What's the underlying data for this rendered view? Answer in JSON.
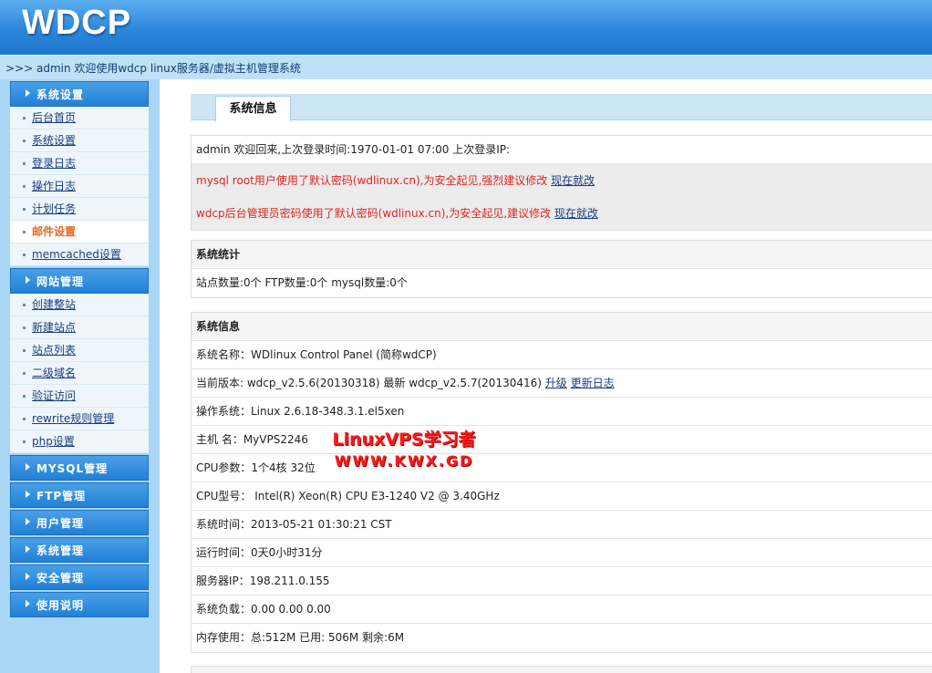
{
  "header": {
    "logo": "WDCP"
  },
  "welcome": ">>> admin 欢迎使用wdcp linux服务器/虚拟主机管理系统",
  "sidebar": {
    "groups": [
      {
        "title": "系统设置",
        "items": [
          "后台首页",
          "系统设置",
          "登录日志",
          "操作日志",
          "计划任务",
          "邮件设置",
          "memcached设置"
        ],
        "active": "邮件设置"
      },
      {
        "title": "网站管理",
        "items": [
          "创建整站",
          "新建站点",
          "站点列表",
          "二级域名",
          "验证访问",
          "rewrite规则管理",
          "php设置"
        ]
      },
      {
        "title": "MYSQL管理",
        "items": []
      },
      {
        "title": "FTP管理",
        "items": []
      },
      {
        "title": "用户管理",
        "items": []
      },
      {
        "title": "系统管理",
        "items": []
      },
      {
        "title": "安全管理",
        "items": []
      },
      {
        "title": "使用说明",
        "items": []
      }
    ]
  },
  "main": {
    "tab": "系统信息",
    "login_info": "admin 欢迎回来,上次登录时间:1970-01-01 07:00 上次登录IP:",
    "warnings": [
      {
        "text": "mysql root用户使用了默认密码(wdlinux.cn),为安全起见,强烈建议修改",
        "link": "现在就改"
      },
      {
        "text": "wdcp后台管理员密码使用了默认密码(wdlinux.cn),为安全起见,建议修改",
        "link": "现在就改"
      }
    ],
    "stats": {
      "title": "系统统计",
      "summary": "站点数量:0个  FTP数量:0个  mysql数量:0个"
    },
    "sysinfo": {
      "title": "系统信息",
      "name": "系统名称：WDlinux Control Panel (简称wdCP)",
      "version": "当前版本: wdcp_v2.5.6(20130318) 最新 wdcp_v2.5.7(20130416)",
      "version_link_upgrade": "升级",
      "version_link_changelog": "更新日志",
      "os": "操作系统：Linux 2.6.18-348.3.1.el5xen",
      "host": "主机 名：MyVPS2246",
      "cpu_params": "CPU参数：1个4核 32位",
      "cpu_model": "CPU型号： Intel(R) Xeon(R) CPU E3-1240 V2 @ 3.40GHz",
      "time": "系统时间：2013-05-21 01:30:21 CST",
      "uptime": "运行时间：0天0小时31分",
      "ip": "服务器IP：198.211.0.155",
      "load": "系统负载：0.00   0.00   0.00",
      "memory": "内存使用：总:512M    已用: 506M    剩余:6M"
    }
  },
  "watermark": {
    "line1": "LinuxVPS学习者",
    "line2": "WWW.KWX.GD"
  },
  "colors": {
    "header": "#2c86da",
    "sidebar": "#a9d6f5",
    "warning": "#e02424",
    "active": "#e66a1d"
  }
}
